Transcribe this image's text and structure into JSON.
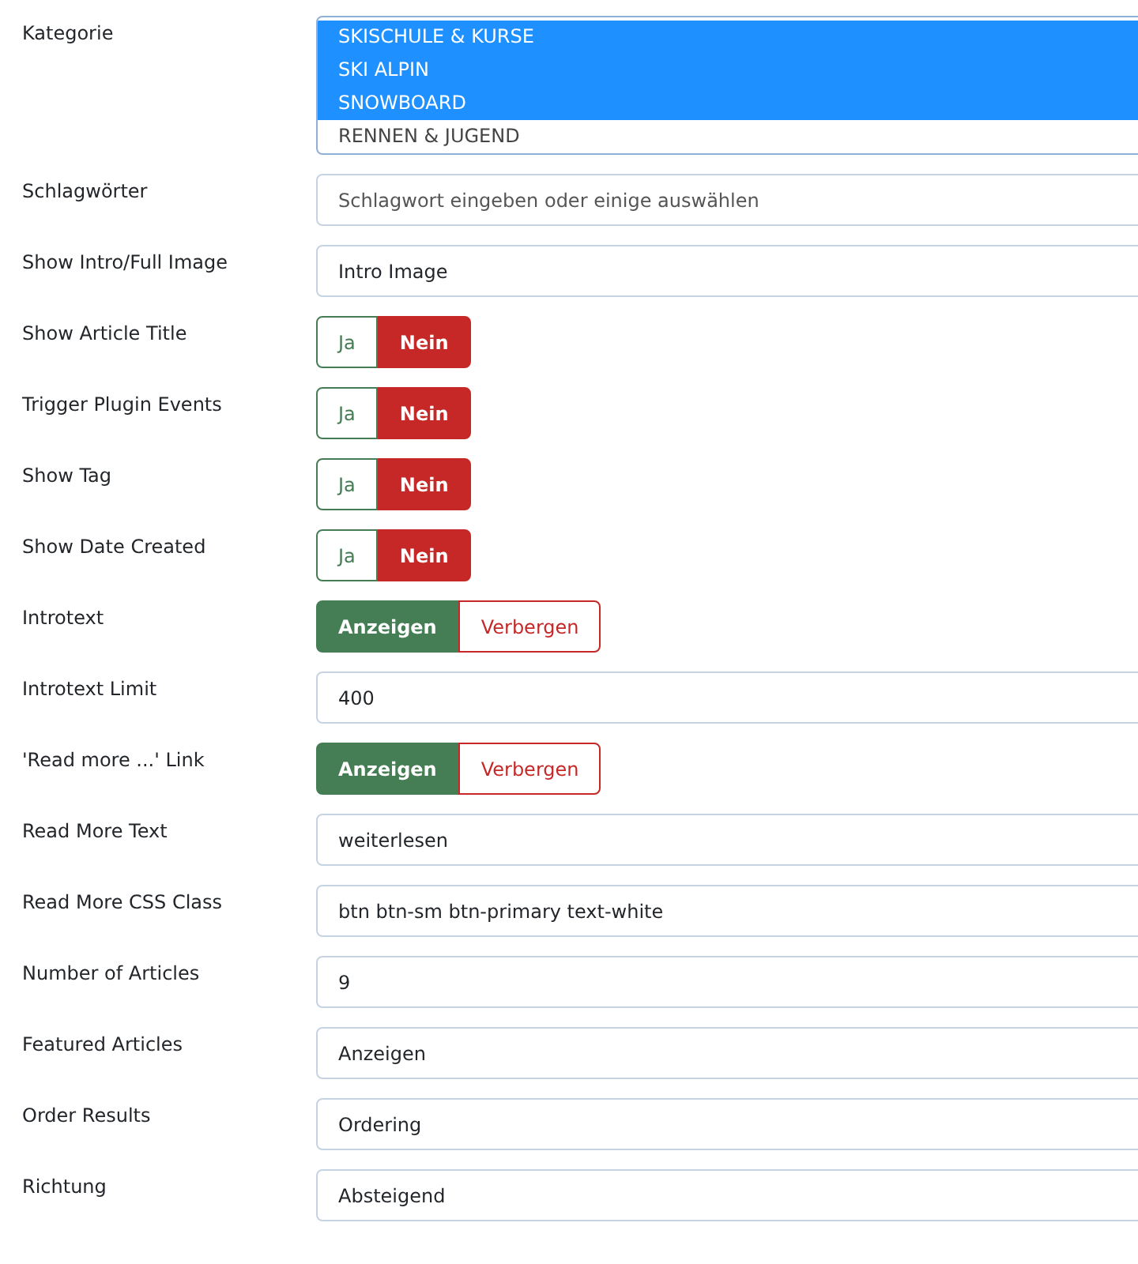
{
  "fields": [
    {
      "label": "Kategorie",
      "kind": "multiselect",
      "options": [
        {
          "text": "SKISCHULE & KURSE",
          "selected": true
        },
        {
          "text": "SKI ALPIN",
          "selected": true
        },
        {
          "text": "SNOWBOARD",
          "selected": true
        },
        {
          "text": "RENNEN & JUGEND",
          "selected": false
        }
      ]
    },
    {
      "label": "Schlagwörter",
      "kind": "text",
      "placeholder": "Schlagwort eingeben oder einige auswählen"
    },
    {
      "label": "Show Intro/Full Image",
      "kind": "text",
      "value": "Intro Image"
    },
    {
      "label": "Show Article Title",
      "kind": "toggle",
      "options": [
        {
          "text": "Ja",
          "selected": false
        },
        {
          "text": "Nein",
          "selected": true
        }
      ]
    },
    {
      "label": "Trigger Plugin Events",
      "kind": "toggle",
      "options": [
        {
          "text": "Ja",
          "selected": false
        },
        {
          "text": "Nein",
          "selected": true
        }
      ]
    },
    {
      "label": "Show Tag",
      "kind": "toggle",
      "options": [
        {
          "text": "Ja",
          "selected": false
        },
        {
          "text": "Nein",
          "selected": true
        }
      ]
    },
    {
      "label": "Show Date Created",
      "kind": "toggle",
      "options": [
        {
          "text": "Ja",
          "selected": false
        },
        {
          "text": "Nein",
          "selected": true
        }
      ]
    },
    {
      "label": "Introtext",
      "kind": "toggle",
      "options": [
        {
          "text": "Anzeigen",
          "selected": true
        },
        {
          "text": "Verbergen",
          "selected": false
        }
      ]
    },
    {
      "label": "Introtext Limit",
      "kind": "text",
      "value": "400"
    },
    {
      "label": "'Read more ...' Link",
      "kind": "toggle",
      "options": [
        {
          "text": "Anzeigen",
          "selected": true
        },
        {
          "text": "Verbergen",
          "selected": false
        }
      ]
    },
    {
      "label": "Read More Text",
      "kind": "text",
      "value": "weiterlesen"
    },
    {
      "label": "Read More CSS Class",
      "kind": "text",
      "value": "btn btn-sm btn-primary text-white"
    },
    {
      "label": "Number of Articles",
      "kind": "text",
      "value": "9"
    },
    {
      "label": "Featured Articles",
      "kind": "text",
      "value": "Anzeigen"
    },
    {
      "label": "Order Results",
      "kind": "text",
      "value": "Ordering"
    },
    {
      "label": "Richtung",
      "kind": "text",
      "value": "Absteigend"
    }
  ]
}
